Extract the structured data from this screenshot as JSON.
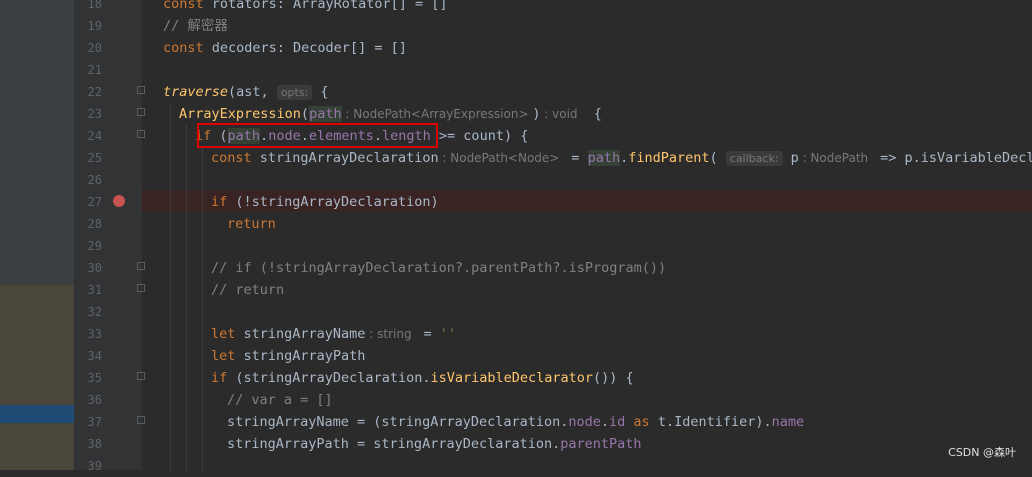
{
  "editor": {
    "line_numbers": [
      "18",
      "19",
      "20",
      "21",
      "22",
      "23",
      "24",
      "25",
      "26",
      "27",
      "28",
      "29",
      "30",
      "31",
      "32",
      "33",
      "34",
      "35",
      "36",
      "37",
      "38",
      "39"
    ],
    "lines": {
      "l18": {
        "a": "const",
        "b": " rotators: ArrayRotator[] = []"
      },
      "l19": {
        "a": "// 解密器"
      },
      "l20": {
        "a": "const",
        "b": " decoders: Decoder[] = []"
      },
      "l22": {
        "a": "traverse",
        "b": "(ast, ",
        "hint": "opts:",
        "c": " {"
      },
      "l23": {
        "a": "ArrayExpression",
        "b": "(",
        "path": "path",
        "hint": " : NodePath<ArrayExpression> ",
        "c": ")",
        "hint2": " : void",
        "d": "  {"
      },
      "l24": {
        "a": "if",
        "b": " (",
        "path": "path",
        "c": ".",
        "d": "node",
        "e": ".",
        "f": "elements",
        "g": ".",
        "h": "length",
        "i": " >= count) {"
      },
      "l25": {
        "a": "const",
        "b": " stringArrayDeclaration",
        "hint": " : NodePath<Node> ",
        "c": " = ",
        "path": "path",
        "d": ".",
        "e": "findParent",
        "f": "( ",
        "hint2": "callback:",
        "g": " p",
        "hint3": " : NodePath ",
        "h": " => p.",
        "i": "isVariableDeclarator"
      },
      "l27": {
        "a": "if",
        "b": " (!stringArrayDeclaration)"
      },
      "l28": {
        "a": "return"
      },
      "l30": {
        "a": "// if (!stringArrayDeclaration?.parentPath?.isProgram())"
      },
      "l31": {
        "a": "// return"
      },
      "l33": {
        "a": "let",
        "b": " stringArrayName",
        "hint": " : string ",
        "c": " = ",
        "d": "''"
      },
      "l34": {
        "a": "let",
        "b": " stringArrayPath"
      },
      "l35": {
        "a": "if",
        "b": " (stringArrayDeclaration.",
        "c": "isVariableDeclarator",
        "d": "()) {"
      },
      "l36": {
        "a": "// var a = []"
      },
      "l37": {
        "a": "stringArrayName = (stringArrayDeclaration.",
        "b": "node",
        "c": ".",
        "d": "id",
        "e": " as",
        "f": " t.Identifier).",
        "g": "name"
      },
      "l38": {
        "a": "stringArrayPath = stringArrayDeclaration.",
        "b": "parentPath"
      }
    }
  },
  "colors": {
    "background": "#2b2b2b",
    "gutter": "#313335",
    "breakpoint": "#c75450",
    "annotation_box": "#e00000"
  },
  "icons": {
    "breakpoint": "breakpoint-icon",
    "fold": "fold-marker-icon"
  },
  "watermark": "CSDN @森叶"
}
